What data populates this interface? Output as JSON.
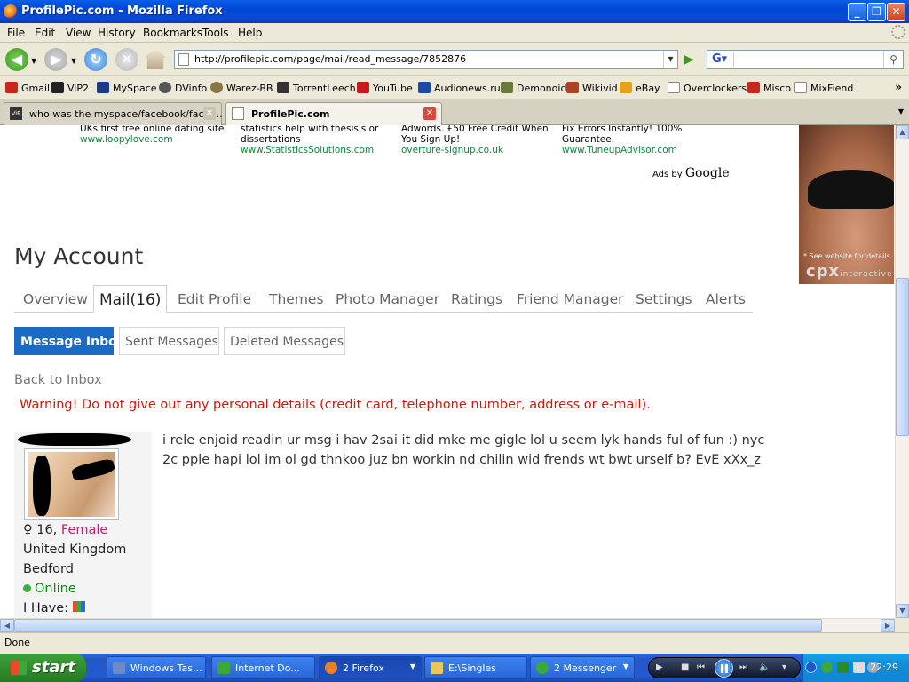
{
  "window": {
    "title": "ProfilePic.com - Mozilla Firefox"
  },
  "menu": [
    "File",
    "Edit",
    "View",
    "History",
    "Bookmarks",
    "Tools",
    "Help"
  ],
  "toolbar": {
    "url": "http://profilepic.com/page/mail/read_message/7852876",
    "search_placeholder": ""
  },
  "bookmarks": [
    {
      "label": "Gmail",
      "color": "#c8281a"
    },
    {
      "label": "ViP2",
      "color": "#222222"
    },
    {
      "label": "MySpace",
      "color": "#1a3a8a"
    },
    {
      "label": "DVinfo",
      "color": "#555555"
    },
    {
      "label": "Warez-BB",
      "color": "#887744"
    },
    {
      "label": "TorrentLeech",
      "color": "#333333"
    },
    {
      "label": "YouTube",
      "color": "#c81a1a"
    },
    {
      "label": "Audionews.ru",
      "color": "#1a4aa8"
    },
    {
      "label": "Demonoid",
      "color": "#6a7a3a"
    },
    {
      "label": "Wikivid",
      "color": "#aa4422"
    },
    {
      "label": "eBay",
      "color": "#e8a21a"
    },
    {
      "label": "Overclockers",
      "color": "#888888"
    },
    {
      "label": "Misco",
      "color": "#c8281a"
    },
    {
      "label": "MixFiend",
      "color": "#888888"
    }
  ],
  "tabs": [
    {
      "label": "who was the myspace/facebook/face-...",
      "icon_text": "ViP"
    },
    {
      "label": "ProfilePic.com"
    }
  ],
  "ads": [
    {
      "text": "UKs first free online dating site.",
      "url": "www.loopylove.com"
    },
    {
      "text": "statistics help with thesis's or dissertations",
      "url": "www.StatisticsSolutions.com"
    },
    {
      "text": "Adwords. £50 Free Credit When You Sign Up!",
      "url": "overture-signup.co.uk"
    },
    {
      "text": "Fix Errors Instantly! 100% Guarantee.",
      "url": "www.TuneupAdvisor.com"
    }
  ],
  "ads_by": {
    "prefix": "Ads by",
    "brand": "Google"
  },
  "side_ad": {
    "caption": "* See website for details",
    "brand": "cpx",
    "brand_sub": "interactive"
  },
  "page": {
    "title": "My Account",
    "account_tabs": [
      "Overview",
      "Mail(16)",
      "Edit Profile",
      "Themes",
      "Photo Manager",
      "Ratings",
      "Friend Manager",
      "Settings",
      "Alerts"
    ],
    "active_account_tab": "Mail(16)",
    "mail_tabs": [
      "Message Inbox",
      "Sent Messages",
      "Deleted Messages"
    ],
    "active_mail_tab": "Message Inbox",
    "back_link": "Back to Inbox",
    "warning": "Warning! Do not give out any personal details (credit card, telephone number, address or e-mail).",
    "sender": {
      "gender_symbol": "♀",
      "age": "16,",
      "gender": "Female",
      "country": "United Kingdom",
      "city": "Bedford",
      "status": "Online",
      "have_label": "I Have:"
    },
    "message": "i rele enjoid readin ur msg i hav 2sai it did mke me gigle lol u seem lyk hands ful of fun :) nyc 2c pple hapi lol im ol gd thnkoo juz bn workin nd chilin wid frends wt bwt urself b? EvE xXx_z"
  },
  "status": "Done",
  "taskbar": {
    "start": "start",
    "items": [
      "Windows Tas...",
      "Internet Do...",
      "2 Firefox",
      "E:\\Singles",
      "2 Messenger"
    ],
    "clock": "22:29"
  },
  "colors": {
    "link_green": "#0a8a3a",
    "warning_red": "#cc1a0a",
    "active_tab_blue": "#1a6bc6",
    "female_pink": "#c0207a"
  }
}
